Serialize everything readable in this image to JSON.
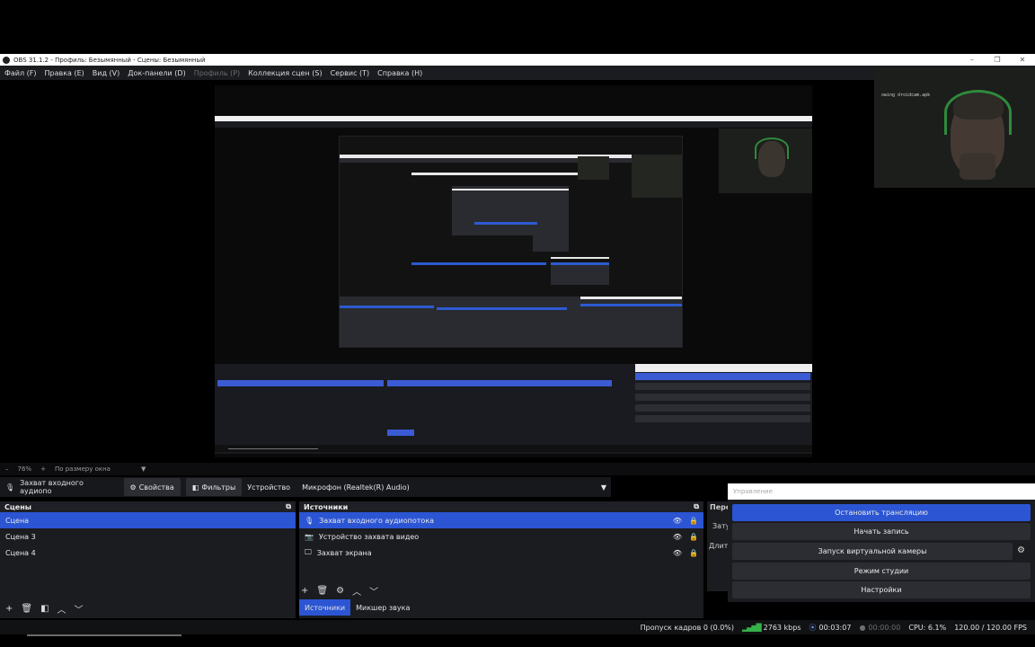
{
  "window": {
    "title": "OBS 31.1.2 - Профиль: Безымянный - Сцены: Безымянный",
    "controls": [
      "–",
      "❐",
      "✕"
    ]
  },
  "menu": [
    "Файл (F)",
    "Правка (E)",
    "Вид (V)",
    "Док-панели (D)",
    "Профиль (P)",
    "Коллекция сцен (S)",
    "Сервис (T)",
    "Справка (H)"
  ],
  "webcam_label": "owing droidcam.apk",
  "zoom": {
    "minus": "–",
    "level": "76%",
    "plus": "+",
    "fit": "По размеру окна"
  },
  "source_toolbar": {
    "selected_source": "Захват входного аудиопо",
    "properties": "Свойства",
    "filters": "Фильтры",
    "device_label": "Устройство",
    "device_value": "Микрофон (Realtek(R) Audio)"
  },
  "scenes": {
    "title": "Сцены",
    "items": [
      "Сцена",
      "Сцена 3",
      "Сцена 4"
    ]
  },
  "sources": {
    "title": "Источники",
    "items": [
      "Захват входного аудиопотока",
      "Устройство захвата видео",
      "Захват экрана"
    ]
  },
  "tabs": [
    "Источники",
    "Микшер звука"
  ],
  "transitions_partial": [
    "Пере",
    "Зату",
    "Длите"
  ],
  "controls": {
    "title": "Управление",
    "buttons": [
      "Остановить трансляцию",
      "Начать запись",
      "Запуск виртуальной камеры",
      "Режим студии",
      "Настройки"
    ]
  },
  "status": {
    "dropped": "Пропуск кадров 0 (0.0%)",
    "bitrate": "2763 kbps",
    "stream_time": "00:03:07",
    "rec_time": "00:00:00",
    "cpu": "CPU: 6.1%",
    "fps": "120.00 / 120.00 FPS"
  },
  "colors": {
    "accent": "#2b55d3",
    "dock_bg": "#1b1c20",
    "signal": "#35b14a"
  }
}
